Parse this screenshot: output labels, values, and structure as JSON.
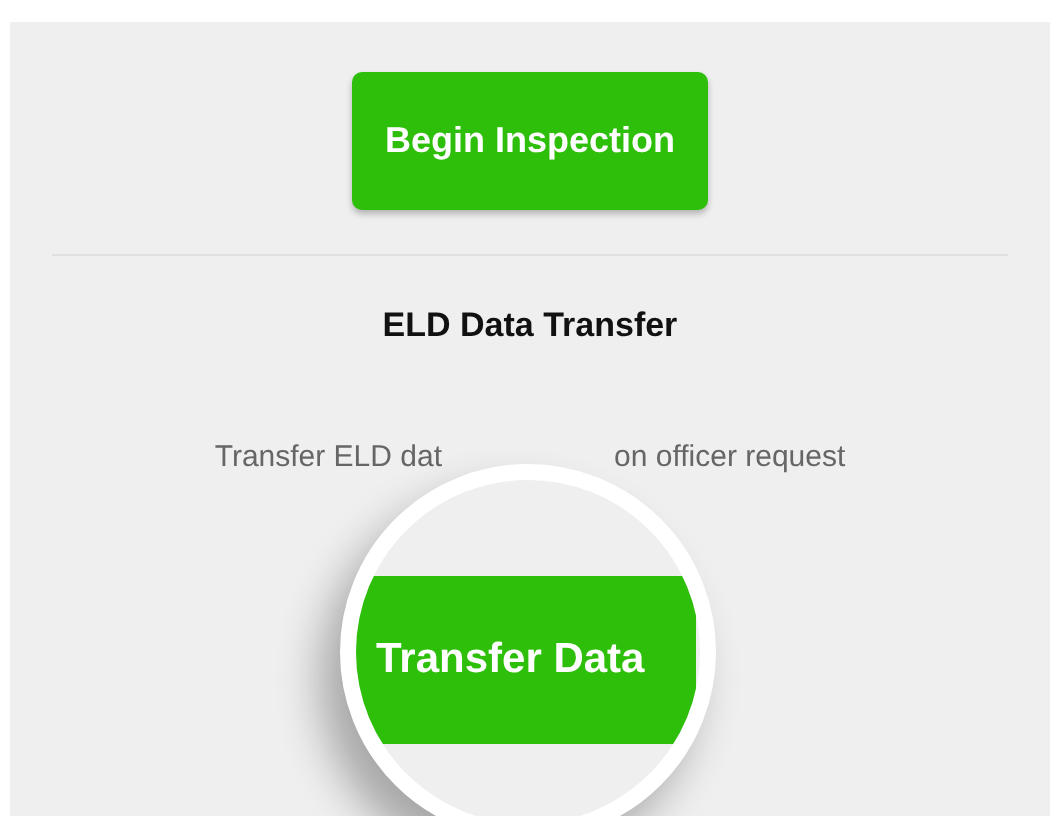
{
  "inspection_button": {
    "label": "Begin Inspection"
  },
  "section": {
    "title": "ELD Data Transfer",
    "description_parts": [
      "Transfer ELD dat",
      "on officer request"
    ]
  },
  "magnifier": {
    "button": {
      "label": "Transfer Data"
    }
  }
}
